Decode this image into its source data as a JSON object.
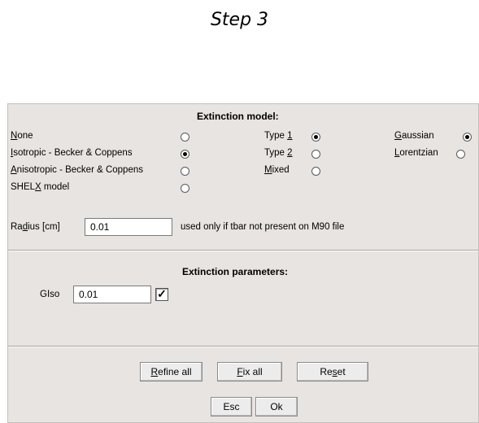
{
  "step_title": "Step 3",
  "extinction_model": {
    "title": "Extinction model:",
    "models": [
      {
        "label": "None",
        "selected": false
      },
      {
        "label": "Isotropic - Becker & Coppens",
        "selected": true
      },
      {
        "label": "Anisotropic - Becker & Coppens",
        "selected": false
      },
      {
        "label": "SHELX model",
        "selected": false
      }
    ],
    "types": [
      {
        "label": "Type 1",
        "selected": true
      },
      {
        "label": "Type 2",
        "selected": false
      },
      {
        "label": "Mixed",
        "selected": false
      }
    ],
    "distributions": [
      {
        "label": "Gaussian",
        "selected": true
      },
      {
        "label": "Lorentzian",
        "selected": false
      }
    ],
    "radius_label": "Radius [cm]",
    "radius_value": "0.01",
    "radius_note": "used only if tbar not present on M90 file"
  },
  "extinction_parameters": {
    "title": "Extinction parameters:",
    "giso_label": "GIso",
    "giso_value": "0.01",
    "giso_refine_checked": true
  },
  "buttons": {
    "refine_all": "Refine all",
    "fix_all": "Fix all",
    "reset": "Reset",
    "esc": "Esc",
    "ok": "Ok"
  }
}
